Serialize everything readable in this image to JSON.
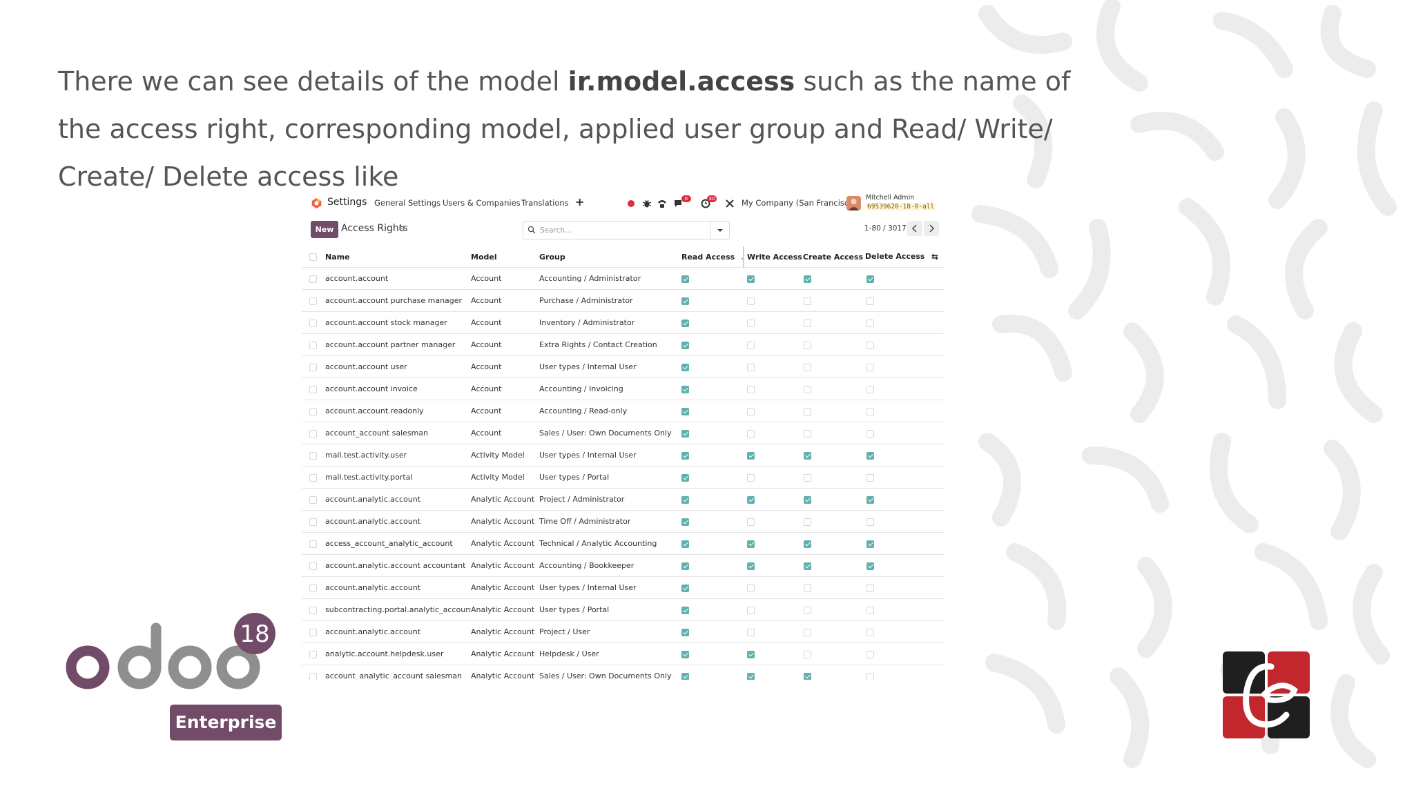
{
  "slide": {
    "text_before": "There we can see details of the model ",
    "text_bold": "ir.model.access",
    "text_after": " such as the name of the access right, corresponding model, applied user group and Read/ Write/ Create/ Delete access like"
  },
  "navbar": {
    "app_title": "Settings",
    "menu": [
      "General Settings",
      "Users & Companies",
      "Translations"
    ],
    "add_symbol": "+",
    "chat_badge": "6",
    "activity_badge": "30",
    "company": "My Company (San Francisco)",
    "user_name": "Mitchell Admin",
    "db_name": "69539620-18-0-all"
  },
  "control_panel": {
    "new_label": "New",
    "breadcrumb": "Access Rights",
    "search_placeholder": "Search...",
    "pager": "1-80 / 3017"
  },
  "table": {
    "columns": [
      "Name",
      "Model",
      "Group",
      "Read Access",
      "Write Access",
      "Create Access",
      "Delete Access"
    ],
    "rows": [
      {
        "name": "account.account",
        "model": "Account",
        "group": "Accounting / Administrator",
        "read": true,
        "write": true,
        "create": true,
        "delete": true
      },
      {
        "name": "account.account purchase manager",
        "model": "Account",
        "group": "Purchase / Administrator",
        "read": true,
        "write": false,
        "create": false,
        "delete": false
      },
      {
        "name": "account.account stock manager",
        "model": "Account",
        "group": "Inventory / Administrator",
        "read": true,
        "write": false,
        "create": false,
        "delete": false
      },
      {
        "name": "account.account partner manager",
        "model": "Account",
        "group": "Extra Rights / Contact Creation",
        "read": true,
        "write": false,
        "create": false,
        "delete": false
      },
      {
        "name": "account.account user",
        "model": "Account",
        "group": "User types / Internal User",
        "read": true,
        "write": false,
        "create": false,
        "delete": false
      },
      {
        "name": "account.account invoice",
        "model": "Account",
        "group": "Accounting / Invoicing",
        "read": true,
        "write": false,
        "create": false,
        "delete": false
      },
      {
        "name": "account.account.readonly",
        "model": "Account",
        "group": "Accounting / Read-only",
        "read": true,
        "write": false,
        "create": false,
        "delete": false
      },
      {
        "name": "account_account salesman",
        "model": "Account",
        "group": "Sales / User: Own Documents Only",
        "read": true,
        "write": false,
        "create": false,
        "delete": false
      },
      {
        "name": "mail.test.activity.user",
        "model": "Activity Model",
        "group": "User types / Internal User",
        "read": true,
        "write": true,
        "create": true,
        "delete": true
      },
      {
        "name": "mail.test.activity.portal",
        "model": "Activity Model",
        "group": "User types / Portal",
        "read": true,
        "write": false,
        "create": false,
        "delete": false
      },
      {
        "name": "account.analytic.account",
        "model": "Analytic Account",
        "group": "Project / Administrator",
        "read": true,
        "write": true,
        "create": true,
        "delete": true
      },
      {
        "name": "account.analytic.account",
        "model": "Analytic Account",
        "group": "Time Off / Administrator",
        "read": true,
        "write": false,
        "create": false,
        "delete": false
      },
      {
        "name": "access_account_analytic_account",
        "model": "Analytic Account",
        "group": "Technical / Analytic Accounting",
        "read": true,
        "write": true,
        "create": true,
        "delete": true
      },
      {
        "name": "account.analytic.account accountant",
        "model": "Analytic Account",
        "group": "Accounting / Bookkeeper",
        "read": true,
        "write": true,
        "create": true,
        "delete": true
      },
      {
        "name": "account.analytic.account",
        "model": "Analytic Account",
        "group": "User types / Internal User",
        "read": true,
        "write": false,
        "create": false,
        "delete": false
      },
      {
        "name": "subcontracting.portal.analytic_account",
        "model": "Analytic Account",
        "group": "User types / Portal",
        "read": true,
        "write": false,
        "create": false,
        "delete": false
      },
      {
        "name": "account.analytic.account",
        "model": "Analytic Account",
        "group": "Project / User",
        "read": true,
        "write": false,
        "create": false,
        "delete": false
      },
      {
        "name": "analytic.account.helpdesk.user",
        "model": "Analytic Account",
        "group": "Helpdesk / User",
        "read": true,
        "write": true,
        "create": false,
        "delete": false
      },
      {
        "name": "account_analytic_account salesman",
        "model": "Analytic Account",
        "group": "Sales / User: Own Documents Only",
        "read": true,
        "write": true,
        "create": true,
        "delete": false
      }
    ]
  },
  "branding": {
    "version": "18",
    "edition": "Enterprise",
    "odoo_color": "#714b67",
    "cb_red": "#c1272d"
  }
}
